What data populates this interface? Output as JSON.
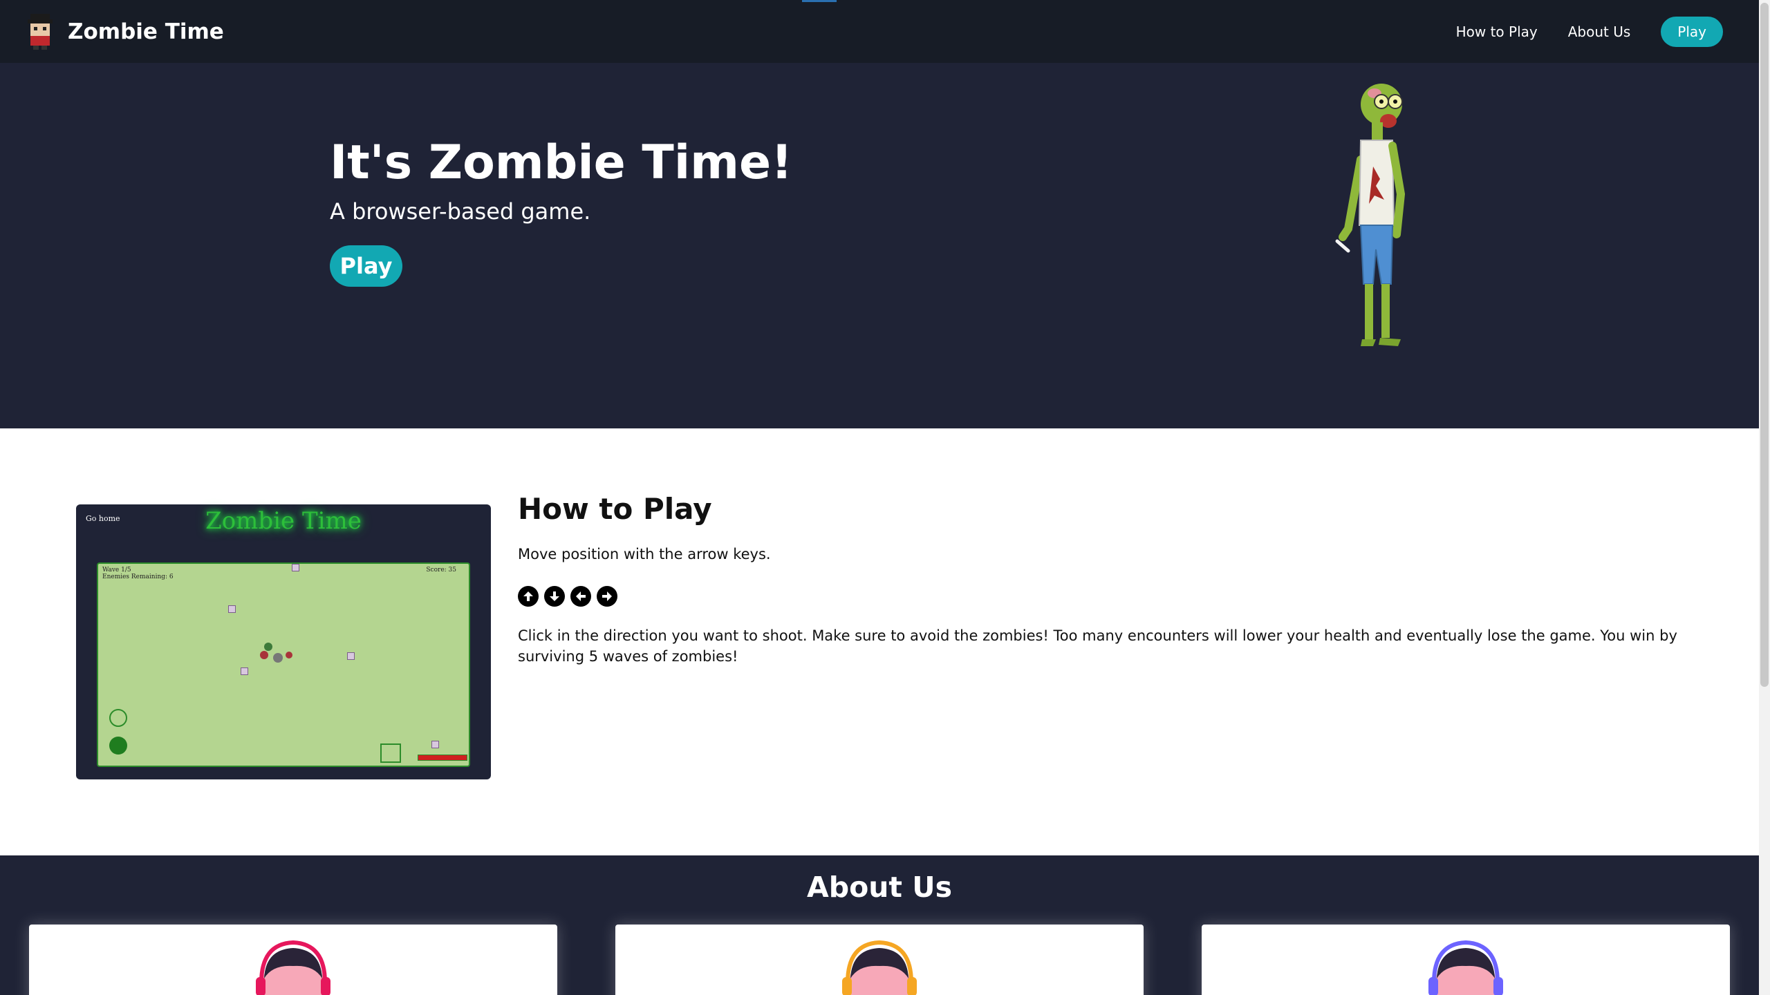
{
  "nav": {
    "brand": "Zombie Time",
    "links": [
      "How to Play",
      "About Us"
    ],
    "play": "Play"
  },
  "hero": {
    "title": "It's Zombie Time!",
    "subtitle": "A browser-based game.",
    "play": "Play"
  },
  "howto": {
    "title": "How to Play",
    "line1": "Move position with the arrow keys.",
    "keys": [
      "arrow-up-icon",
      "arrow-down-icon",
      "arrow-left-icon",
      "arrow-right-icon"
    ],
    "line2": "Click in the direction you want to shoot. Make sure to avoid the zombies! Too many encounters will lower your health and eventually lose the game. You win by surviving 5 waves of zombies!",
    "screenshot": {
      "go_home": "Go home",
      "game_title": "Zombie Time",
      "wave": "Wave 1/5",
      "enemies": "Enemies Remaining: 6",
      "score": "Score: 35"
    }
  },
  "about": {
    "title": "About Us",
    "avatar_colors": [
      "#e6175c",
      "#f5a623",
      "#6c63ff"
    ]
  },
  "colors": {
    "nav_bg": "#171c26",
    "hero_bg": "#1f2336",
    "accent": "#12a8b3"
  }
}
